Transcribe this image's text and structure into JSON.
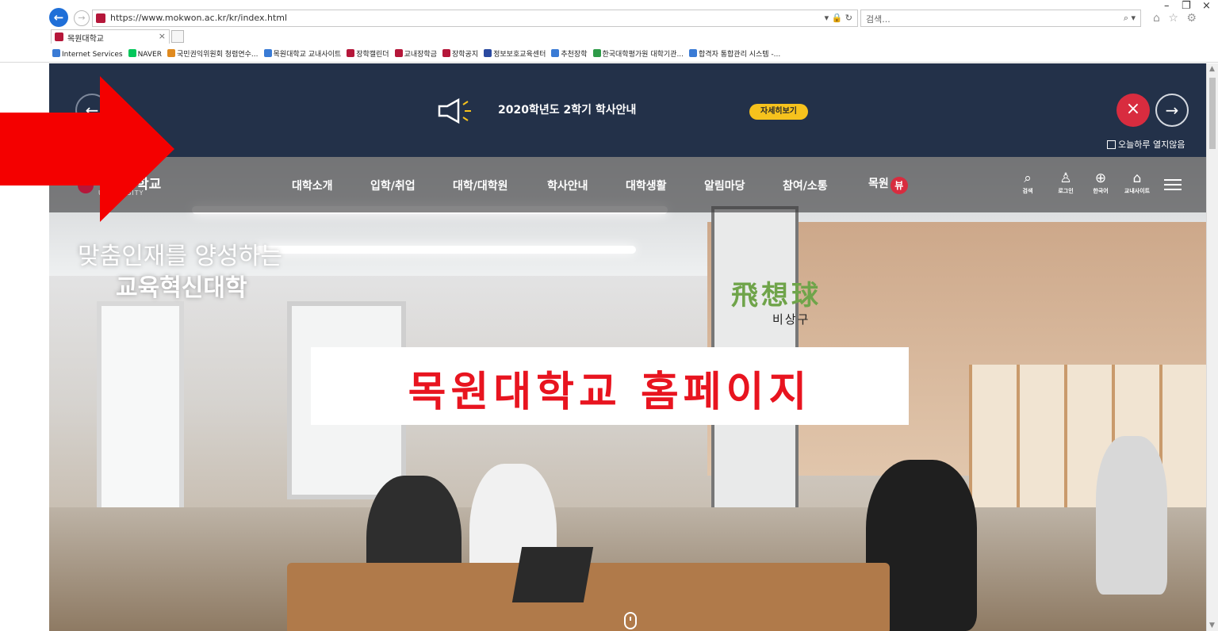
{
  "browser": {
    "url": "https://www.mokwon.ac.kr/kr/index.html",
    "search_placeholder": "검색...",
    "tab_title": "목원대학교",
    "tab_close": "×",
    "win_min": "–",
    "win_max": "❐",
    "win_close": "×",
    "toolbar_icons": "⌂ ☆ ⚙",
    "url_tools": "▾ 🔒 ↻",
    "search_tool": "⌕ ▾",
    "favorites": [
      {
        "label": "Internet Services",
        "color": "#3a7bd5"
      },
      {
        "label": "NAVER",
        "color": "#03c75a"
      },
      {
        "label": "국민권익위원회 청렴연수...",
        "color": "#e08a1e"
      },
      {
        "label": "목원대학교 교내사이트",
        "color": "#3a7bd5"
      },
      {
        "label": "장학캘린더",
        "color": "#b5173a"
      },
      {
        "label": "교내장학금",
        "color": "#b5173a"
      },
      {
        "label": "장학공지",
        "color": "#b5173a"
      },
      {
        "label": "정보보호교육센터",
        "color": "#2b4aa0"
      },
      {
        "label": "추천장학",
        "color": "#3a7bd5"
      },
      {
        "label": "한국대학평가원 대학기관...",
        "color": "#2e9b48"
      },
      {
        "label": "합격자 통합관리 시스템 -...",
        "color": "#3a7bd5"
      }
    ]
  },
  "notice": {
    "text": "2020학년도 2학기 학사안내",
    "button": "자세히보기",
    "prev": "←",
    "next": "→",
    "close": "×",
    "dont_show": "오늘하루 열지않음"
  },
  "site": {
    "logo_text": "학교",
    "logo_sub": "UNIVERSITY",
    "nav": [
      "대학소개",
      "입학/취업",
      "대학/대학원",
      "학사안내",
      "대학생활",
      "알림마당",
      "참여/소통",
      "목원"
    ],
    "nav_badge": "뷰",
    "util": [
      {
        "icon": "⌕",
        "label": "검색"
      },
      {
        "icon": "♙",
        "label": "로그인"
      },
      {
        "icon": "⊕",
        "label": "한국어"
      },
      {
        "icon": "⌂",
        "label": "교내사이트"
      }
    ]
  },
  "hero": {
    "line1": "맞춤인재를 양성하는",
    "line2": "교육혁신대학",
    "sign": "飛想球",
    "sign_sub": "비상구"
  },
  "caption": "목원대학교 홈페이지",
  "colors": {
    "notice_bg": "#233149",
    "accent_red": "#d82c3f",
    "button_yellow": "#f6c21d",
    "caption_red": "#e8141f",
    "arrow_red": "#f40000"
  }
}
